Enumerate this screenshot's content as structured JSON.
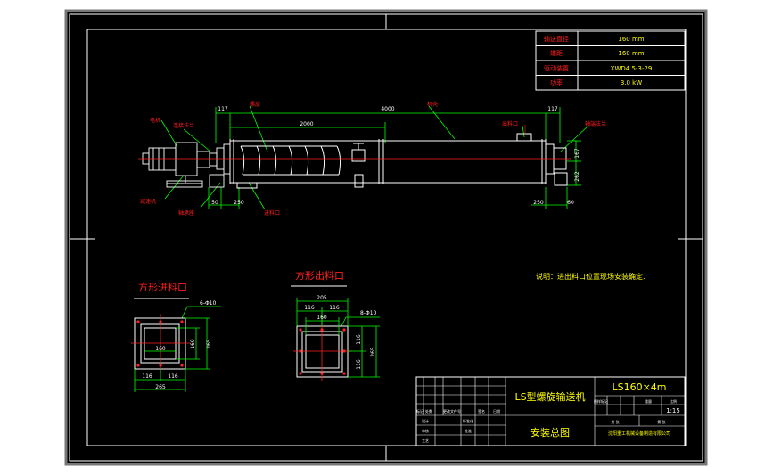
{
  "params_table": [
    {
      "label": "输送直径",
      "value": "160 mm"
    },
    {
      "label": "螺距",
      "value": "160 mm"
    },
    {
      "label": "驱动装置",
      "value": "XWD4.5-3-29"
    },
    {
      "label": "功率",
      "value": "3.0 kW"
    }
  ],
  "main_view": {
    "top_dims": {
      "left": "117",
      "overall": "4000",
      "right": "117"
    },
    "inner_dim": "2000",
    "labels": {
      "motor": "电机",
      "coupling": "连接法兰",
      "spiral": "螺旋",
      "housing": "机壳",
      "outlet": "出料口",
      "end_flange": "轴端法兰",
      "reducer": "减速机",
      "bearing_seat": "轴承座",
      "inlet": "进料口"
    },
    "bottom_dims": {
      "d50": "50",
      "d250a": "250",
      "d250b": "250",
      "d60": "60"
    },
    "side_dims": {
      "h1": "167",
      "h2": "262"
    }
  },
  "note": "说明：进出料口位置现场安装确定.",
  "inlet_view": {
    "title": "方形进料口",
    "hole_spec": "6-Φ10",
    "dims": {
      "w1": "160",
      "h1": "160",
      "hh": "265",
      "b1": "116",
      "b2": "116",
      "total": "265"
    }
  },
  "outlet_view": {
    "title": "方形出料口",
    "hole_spec": "8-Φ10",
    "dims": {
      "top": "205",
      "t1": "116",
      "t2": "116",
      "w": "160",
      "r1": "116",
      "r2": "116",
      "rh": "265"
    }
  },
  "title_block": {
    "product": "LS型螺旋输送机",
    "model": "LS160×4m",
    "drawing": "安装总图",
    "scale": "1:15",
    "company": "沈阳重工机械设备制造有限公司",
    "small": [
      "图样标记",
      "重量",
      "比例",
      "共 张",
      "第 张",
      "标记",
      "处数",
      "更改文件号",
      "签名",
      "日期",
      "设计",
      "审核",
      "工艺",
      "标准化",
      "批准"
    ]
  }
}
